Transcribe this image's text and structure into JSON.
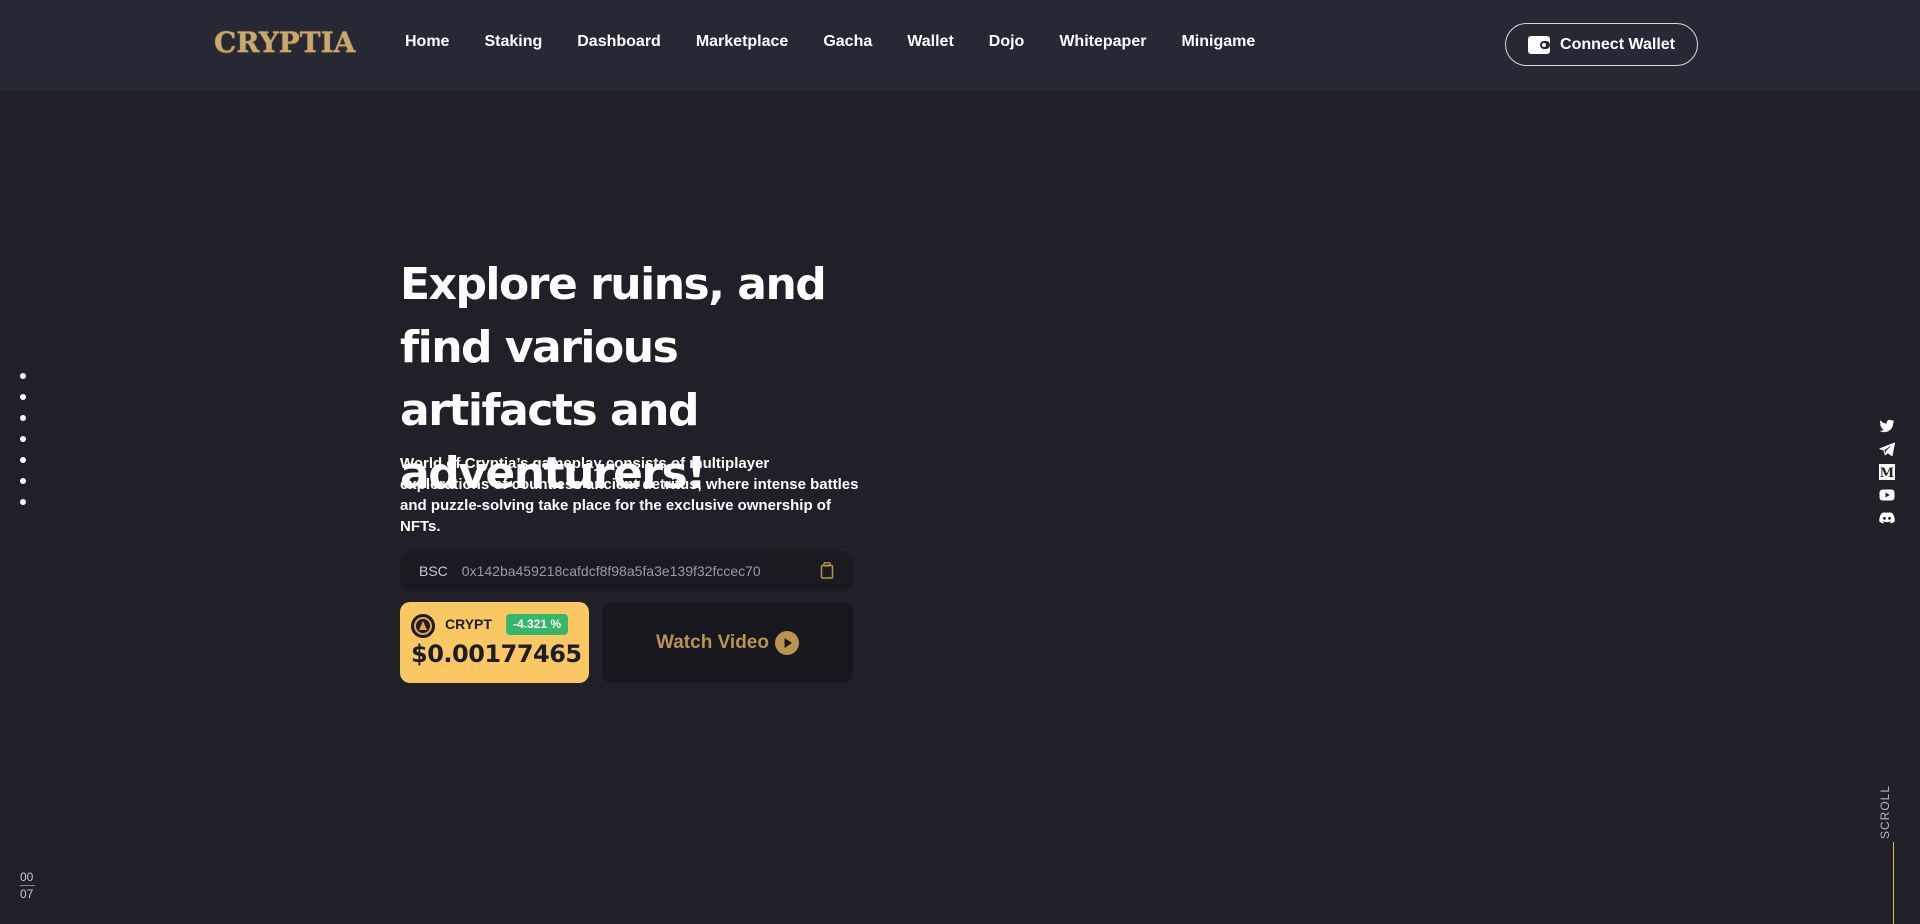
{
  "header": {
    "logo": "CRYPTIA",
    "nav": [
      "Home",
      "Staking",
      "Dashboard",
      "Marketplace",
      "Gacha",
      "Wallet",
      "Dojo",
      "Whitepaper",
      "Minigame"
    ],
    "connect_label": "Connect Wallet"
  },
  "pagination": {
    "current": "00",
    "total": "07",
    "dot_count": 7
  },
  "hero": {
    "title": "Explore ruins, and find various artifacts and adventurers!",
    "description": "World of Cryptia’s gameplay consists of multiplayer explorations of countless ancient detritus, where intense battles and puzzle-solving take place for the exclusive ownership of NFTs.",
    "contract": {
      "chain": "BSC",
      "address": "0x142ba459218cafdcf8f98a5fa3e139f32fccec70"
    },
    "token": {
      "symbol": "CRYPT",
      "change": "-4.321 %",
      "price": "$0.00177465"
    },
    "video_label": "Watch Video"
  },
  "socials": [
    "twitter-icon",
    "telegram-icon",
    "medium-icon",
    "youtube-icon",
    "discord-icon"
  ],
  "scroll_label": "SCROLL",
  "colors": {
    "background": "#1f2028",
    "header": "#262834",
    "accent_gold": "#f9c862",
    "video_text": "#b99350",
    "positive_badge": "#35b66a"
  }
}
